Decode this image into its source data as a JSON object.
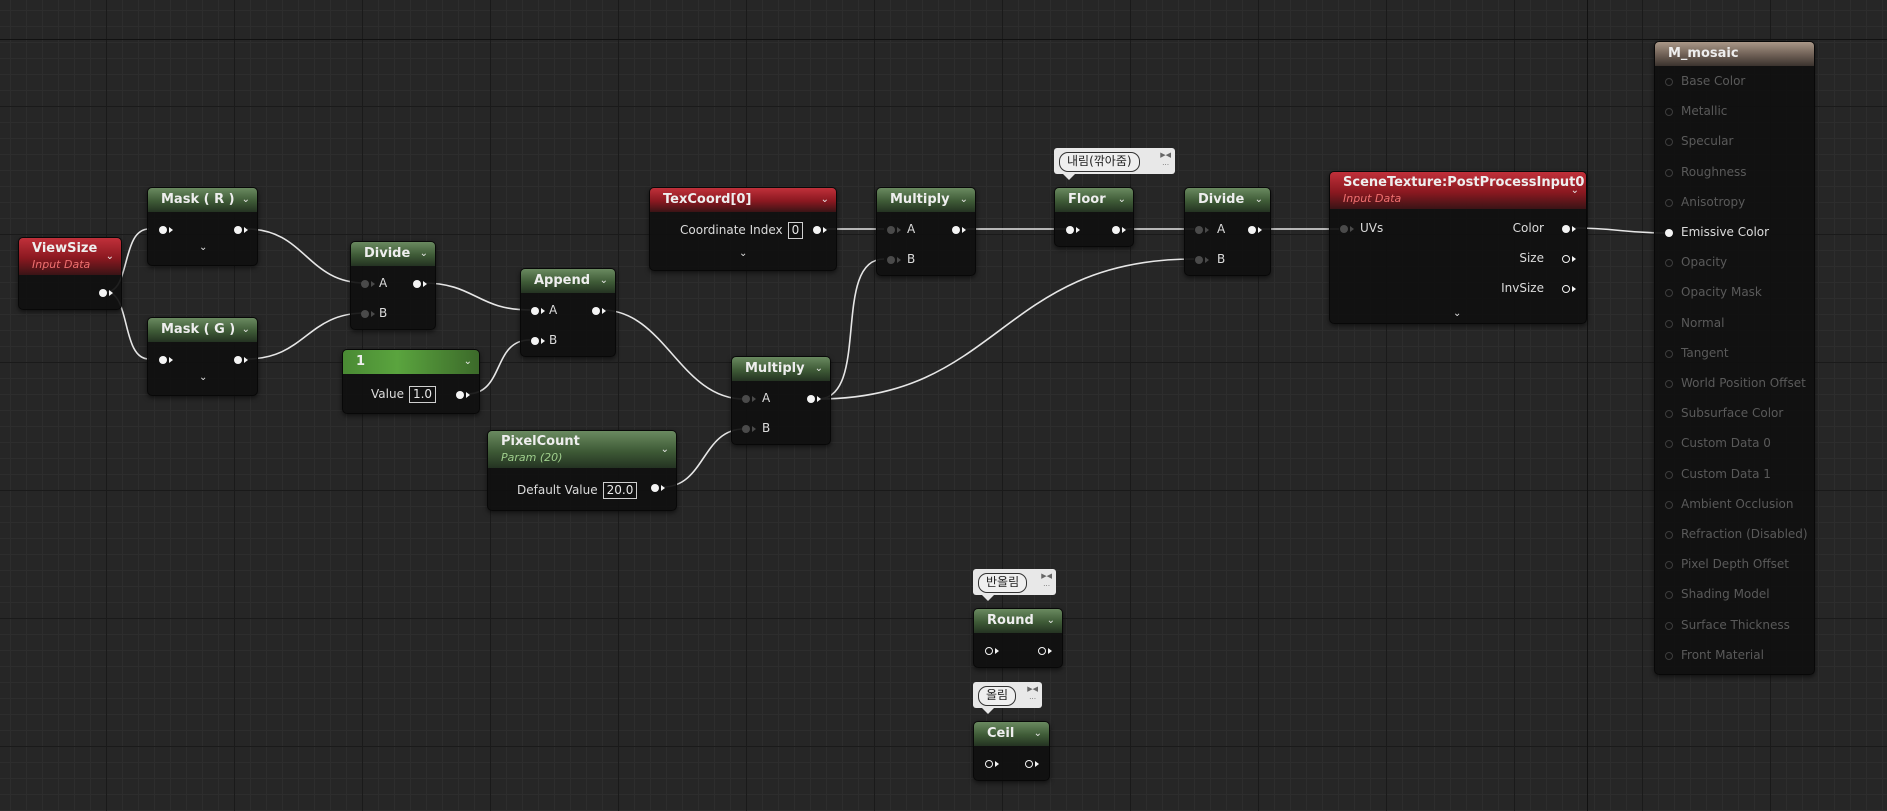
{
  "graph": {
    "viewsize": {
      "title": "ViewSize",
      "subtitle": "Input Data"
    },
    "mask_r": {
      "title": "Mask ( R )"
    },
    "mask_g": {
      "title": "Mask ( G )"
    },
    "divide1": {
      "title": "Divide",
      "pin_a": "A",
      "pin_b": "B"
    },
    "append": {
      "title": "Append",
      "pin_a": "A",
      "pin_b": "B"
    },
    "const1": {
      "title": "1",
      "value_label": "Value",
      "value": "1.0"
    },
    "texcoord": {
      "title": "TexCoord[0]",
      "param_label": "Coordinate Index",
      "param_value": "0"
    },
    "multiply1": {
      "title": "Multiply",
      "pin_a": "A",
      "pin_b": "B"
    },
    "multiply2": {
      "title": "Multiply",
      "pin_a": "A",
      "pin_b": "B"
    },
    "pixelcount": {
      "title": "PixelCount",
      "subtitle": "Param (20)",
      "param_label": "Default Value",
      "param_value": "20.0"
    },
    "floor": {
      "title": "Floor",
      "comment": "내림(깎아줌)"
    },
    "divide2": {
      "title": "Divide",
      "pin_a": "A",
      "pin_b": "B"
    },
    "scenetexture": {
      "title": "SceneTexture:PostProcessInput0",
      "subtitle": "Input Data",
      "input": "UVs",
      "outputs": [
        "Color",
        "Size",
        "InvSize"
      ]
    },
    "round": {
      "title": "Round",
      "comment": "반올림"
    },
    "ceil": {
      "title": "Ceil",
      "comment": "올림"
    }
  },
  "material": {
    "title": "M_mosaic",
    "inputs": [
      {
        "label": "Base Color",
        "active": false
      },
      {
        "label": "Metallic",
        "active": false
      },
      {
        "label": "Specular",
        "active": false
      },
      {
        "label": "Roughness",
        "active": false
      },
      {
        "label": "Anisotropy",
        "active": false
      },
      {
        "label": "Emissive Color",
        "active": true
      },
      {
        "label": "Opacity",
        "active": false
      },
      {
        "label": "Opacity Mask",
        "active": false
      },
      {
        "label": "Normal",
        "active": false
      },
      {
        "label": "Tangent",
        "active": false
      },
      {
        "label": "World Position Offset",
        "active": false
      },
      {
        "label": "Subsurface Color",
        "active": false
      },
      {
        "label": "Custom Data 0",
        "active": false
      },
      {
        "label": "Custom Data 1",
        "active": false
      },
      {
        "label": "Ambient Occlusion",
        "active": false
      },
      {
        "label": "Refraction (Disabled)",
        "active": false
      },
      {
        "label": "Pixel Depth Offset",
        "active": false
      },
      {
        "label": "Shading Model",
        "active": false
      },
      {
        "label": "Surface Thickness",
        "active": false
      },
      {
        "label": "Front Material",
        "active": false
      }
    ]
  },
  "icons": {
    "expand": "chevron-down-icon",
    "pin": "pin-icon",
    "comment": "comment-bubble-icon"
  },
  "colors": {
    "function_header": "#4e6e46",
    "input_header": "#a0202a",
    "result_header": "#8c7a6c",
    "wire": "#e6e6e6"
  }
}
